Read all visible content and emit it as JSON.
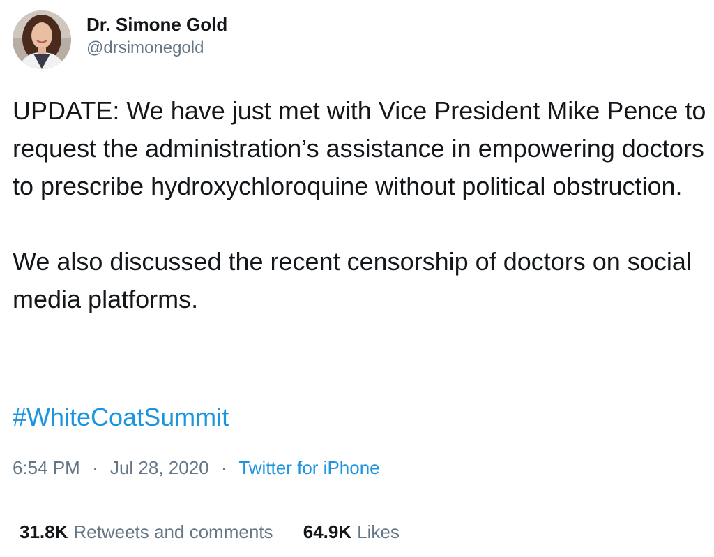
{
  "author": {
    "display_name": "Dr. Simone Gold",
    "handle": "@drsimonegold"
  },
  "tweet": {
    "paragraph_1": "UPDATE: We have just met with Vice President Mike Pence to request the administration’s assistance in empowering doctors to prescribe hydroxychloroquine without political obstruction.",
    "paragraph_2": "We also discussed the recent censorship of doctors on social media platforms.",
    "hashtag": "#WhiteCoatSummit"
  },
  "meta": {
    "time": "6:54 PM",
    "date": "Jul 28, 2020",
    "separator": "·",
    "source": "Twitter for iPhone"
  },
  "stats": {
    "retweets_count": "31.8K",
    "retweets_label": "Retweets and comments",
    "likes_count": "64.9K",
    "likes_label": "Likes"
  },
  "colors": {
    "link": "#1b95e0",
    "secondary_text": "#657786",
    "primary_text": "#14171a",
    "divider": "#e1e8ed"
  }
}
